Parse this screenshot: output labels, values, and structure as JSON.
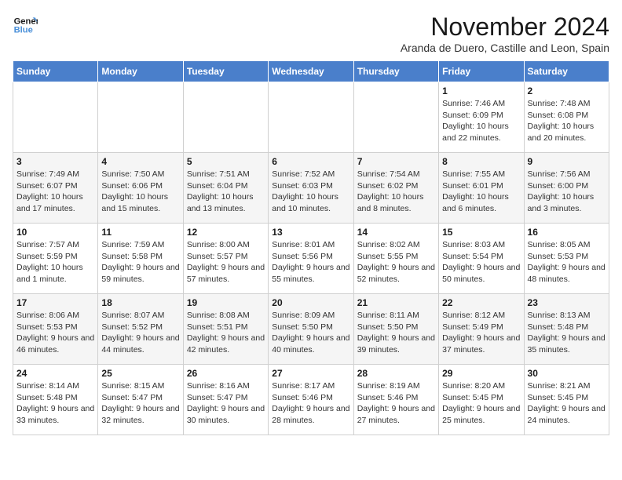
{
  "logo": {
    "line1": "General",
    "line2": "Blue"
  },
  "title": "November 2024",
  "subtitle": "Aranda de Duero, Castille and Leon, Spain",
  "weekdays": [
    "Sunday",
    "Monday",
    "Tuesday",
    "Wednesday",
    "Thursday",
    "Friday",
    "Saturday"
  ],
  "weeks": [
    [
      {
        "day": "",
        "info": ""
      },
      {
        "day": "",
        "info": ""
      },
      {
        "day": "",
        "info": ""
      },
      {
        "day": "",
        "info": ""
      },
      {
        "day": "",
        "info": ""
      },
      {
        "day": "1",
        "info": "Sunrise: 7:46 AM\nSunset: 6:09 PM\nDaylight: 10 hours and 22 minutes."
      },
      {
        "day": "2",
        "info": "Sunrise: 7:48 AM\nSunset: 6:08 PM\nDaylight: 10 hours and 20 minutes."
      }
    ],
    [
      {
        "day": "3",
        "info": "Sunrise: 7:49 AM\nSunset: 6:07 PM\nDaylight: 10 hours and 17 minutes."
      },
      {
        "day": "4",
        "info": "Sunrise: 7:50 AM\nSunset: 6:06 PM\nDaylight: 10 hours and 15 minutes."
      },
      {
        "day": "5",
        "info": "Sunrise: 7:51 AM\nSunset: 6:04 PM\nDaylight: 10 hours and 13 minutes."
      },
      {
        "day": "6",
        "info": "Sunrise: 7:52 AM\nSunset: 6:03 PM\nDaylight: 10 hours and 10 minutes."
      },
      {
        "day": "7",
        "info": "Sunrise: 7:54 AM\nSunset: 6:02 PM\nDaylight: 10 hours and 8 minutes."
      },
      {
        "day": "8",
        "info": "Sunrise: 7:55 AM\nSunset: 6:01 PM\nDaylight: 10 hours and 6 minutes."
      },
      {
        "day": "9",
        "info": "Sunrise: 7:56 AM\nSunset: 6:00 PM\nDaylight: 10 hours and 3 minutes."
      }
    ],
    [
      {
        "day": "10",
        "info": "Sunrise: 7:57 AM\nSunset: 5:59 PM\nDaylight: 10 hours and 1 minute."
      },
      {
        "day": "11",
        "info": "Sunrise: 7:59 AM\nSunset: 5:58 PM\nDaylight: 9 hours and 59 minutes."
      },
      {
        "day": "12",
        "info": "Sunrise: 8:00 AM\nSunset: 5:57 PM\nDaylight: 9 hours and 57 minutes."
      },
      {
        "day": "13",
        "info": "Sunrise: 8:01 AM\nSunset: 5:56 PM\nDaylight: 9 hours and 55 minutes."
      },
      {
        "day": "14",
        "info": "Sunrise: 8:02 AM\nSunset: 5:55 PM\nDaylight: 9 hours and 52 minutes."
      },
      {
        "day": "15",
        "info": "Sunrise: 8:03 AM\nSunset: 5:54 PM\nDaylight: 9 hours and 50 minutes."
      },
      {
        "day": "16",
        "info": "Sunrise: 8:05 AM\nSunset: 5:53 PM\nDaylight: 9 hours and 48 minutes."
      }
    ],
    [
      {
        "day": "17",
        "info": "Sunrise: 8:06 AM\nSunset: 5:53 PM\nDaylight: 9 hours and 46 minutes."
      },
      {
        "day": "18",
        "info": "Sunrise: 8:07 AM\nSunset: 5:52 PM\nDaylight: 9 hours and 44 minutes."
      },
      {
        "day": "19",
        "info": "Sunrise: 8:08 AM\nSunset: 5:51 PM\nDaylight: 9 hours and 42 minutes."
      },
      {
        "day": "20",
        "info": "Sunrise: 8:09 AM\nSunset: 5:50 PM\nDaylight: 9 hours and 40 minutes."
      },
      {
        "day": "21",
        "info": "Sunrise: 8:11 AM\nSunset: 5:50 PM\nDaylight: 9 hours and 39 minutes."
      },
      {
        "day": "22",
        "info": "Sunrise: 8:12 AM\nSunset: 5:49 PM\nDaylight: 9 hours and 37 minutes."
      },
      {
        "day": "23",
        "info": "Sunrise: 8:13 AM\nSunset: 5:48 PM\nDaylight: 9 hours and 35 minutes."
      }
    ],
    [
      {
        "day": "24",
        "info": "Sunrise: 8:14 AM\nSunset: 5:48 PM\nDaylight: 9 hours and 33 minutes."
      },
      {
        "day": "25",
        "info": "Sunrise: 8:15 AM\nSunset: 5:47 PM\nDaylight: 9 hours and 32 minutes."
      },
      {
        "day": "26",
        "info": "Sunrise: 8:16 AM\nSunset: 5:47 PM\nDaylight: 9 hours and 30 minutes."
      },
      {
        "day": "27",
        "info": "Sunrise: 8:17 AM\nSunset: 5:46 PM\nDaylight: 9 hours and 28 minutes."
      },
      {
        "day": "28",
        "info": "Sunrise: 8:19 AM\nSunset: 5:46 PM\nDaylight: 9 hours and 27 minutes."
      },
      {
        "day": "29",
        "info": "Sunrise: 8:20 AM\nSunset: 5:45 PM\nDaylight: 9 hours and 25 minutes."
      },
      {
        "day": "30",
        "info": "Sunrise: 8:21 AM\nSunset: 5:45 PM\nDaylight: 9 hours and 24 minutes."
      }
    ]
  ]
}
